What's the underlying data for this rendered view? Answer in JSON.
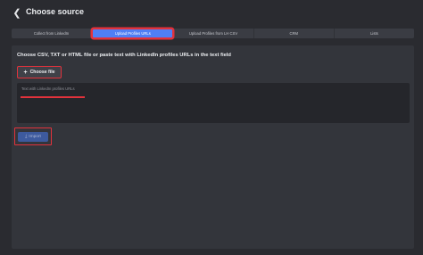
{
  "header": {
    "back_icon": "chevron-left-icon",
    "title": "Choose source"
  },
  "tabs": [
    {
      "label": "Collect from LinkedIn",
      "active": false
    },
    {
      "label": "Upload Profiles URLs",
      "active": true
    },
    {
      "label": "Upload Profiles from LH CSV",
      "active": false
    },
    {
      "label": "CRM",
      "active": false
    },
    {
      "label": "Lists",
      "active": false
    }
  ],
  "main": {
    "instruction": "Choose CSV, TXT or HTML file or paste text with LinkedIn profiles URLs in the text field",
    "choose_file_label": "Choose file",
    "choose_file_icon": "plus-icon",
    "textarea_placeholder": "Text with LinkedIn profiles URLs",
    "import_label": "Import",
    "import_icon": "download-icon"
  },
  "colors": {
    "background": "#2a2b30",
    "panel": "#33353b",
    "accent": "#4f7ff5",
    "highlight": "#e2323c"
  }
}
